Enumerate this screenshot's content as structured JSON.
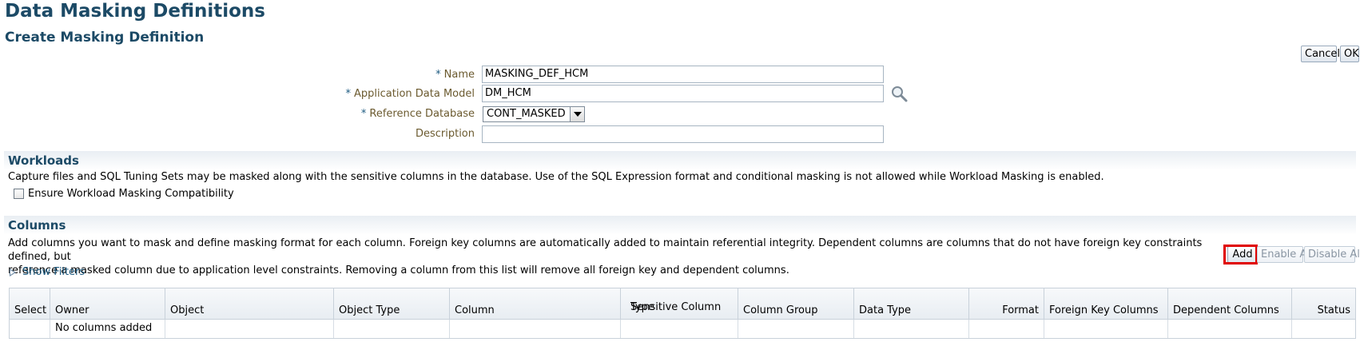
{
  "page": {
    "title": "Data Masking Definitions",
    "subtitle": "Create Masking Definition"
  },
  "top_actions": {
    "cancel_label": "Cancel",
    "ok_label": "OK"
  },
  "form": {
    "required_mark": "*",
    "name_label": "Name",
    "name_value": "MASKING_DEF_HCM",
    "adm_label": "Application Data Model",
    "adm_value": "DM_HCM",
    "ref_db_label": "Reference Database",
    "ref_db_value": "CONT_MASKED",
    "description_label": "Description",
    "description_value": ""
  },
  "workloads": {
    "header": "Workloads",
    "text": "Capture files and SQL Tuning Sets may be masked along with the sensitive columns in the database. Use of the SQL Expression format and conditional masking is not allowed while Workload Masking is enabled.",
    "checkbox_label": "Ensure Workload Masking Compatibility",
    "checkbox_checked": false
  },
  "columns": {
    "header": "Columns",
    "text_line1": "Add columns you want to mask and define masking format for each column. Foreign key columns are automatically added to maintain referential integrity. Dependent columns are columns that do not have foreign key constraints defined, but",
    "text_line2": "reference a masked column due to application level constraints. Removing a column from this list will remove all foreign key and dependent columns.",
    "show_filters": "Show Filters",
    "add_label": "Add",
    "enable_all_label": "Enable All",
    "disable_all_label": "Disable All",
    "table_headers": {
      "select": "Select",
      "owner": "Owner",
      "object": "Object",
      "object_type": "Object Type",
      "column": "Column",
      "sensitive_line1": "Sensitive Column",
      "sensitive_line2": "Type",
      "column_group": "Column Group",
      "data_type": "Data Type",
      "format": "Format",
      "foreign_key_columns": "Foreign Key Columns",
      "dependent_columns": "Dependent Columns",
      "status": "Status"
    },
    "empty_message": "No columns added"
  },
  "icons": {
    "search": "search-icon",
    "dropdown": "chevron-down-icon",
    "disclosure": "disclosure-triangle-icon"
  },
  "colors": {
    "heading": "#1c4a66",
    "label": "#6b5a2f",
    "link": "#1c5a80",
    "highlight": "#e00000"
  }
}
